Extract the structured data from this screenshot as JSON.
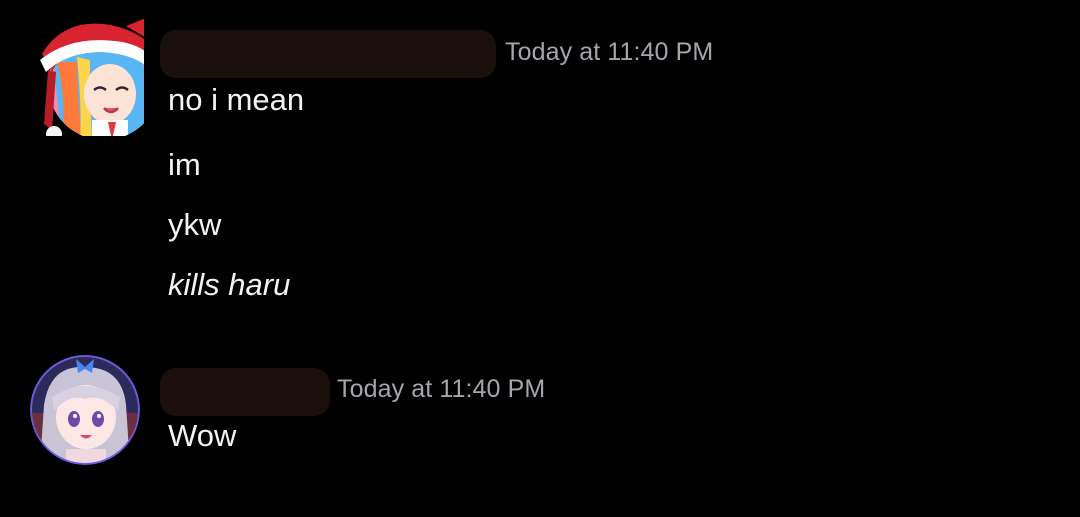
{
  "messages": [
    {
      "author_redacted": true,
      "timestamp": "Today at 11:40 PM",
      "avatar_icon": "anime-avatar-santa-hat-icon",
      "lines": [
        {
          "text": "no i mean",
          "italic": false
        },
        {
          "text": "im",
          "italic": false
        },
        {
          "text": "ykw",
          "italic": false
        },
        {
          "text": "kills haru",
          "italic": true
        }
      ]
    },
    {
      "author_redacted": true,
      "timestamp": "Today at 11:40 PM",
      "avatar_icon": "anime-avatar-silver-hair-icon",
      "lines": [
        {
          "text": "Wow",
          "italic": false
        }
      ]
    }
  ],
  "colors": {
    "background": "#000000",
    "message_text": "#f2f3f5",
    "timestamp_text": "#a3a6ad",
    "redaction": "#1b0f0b"
  }
}
